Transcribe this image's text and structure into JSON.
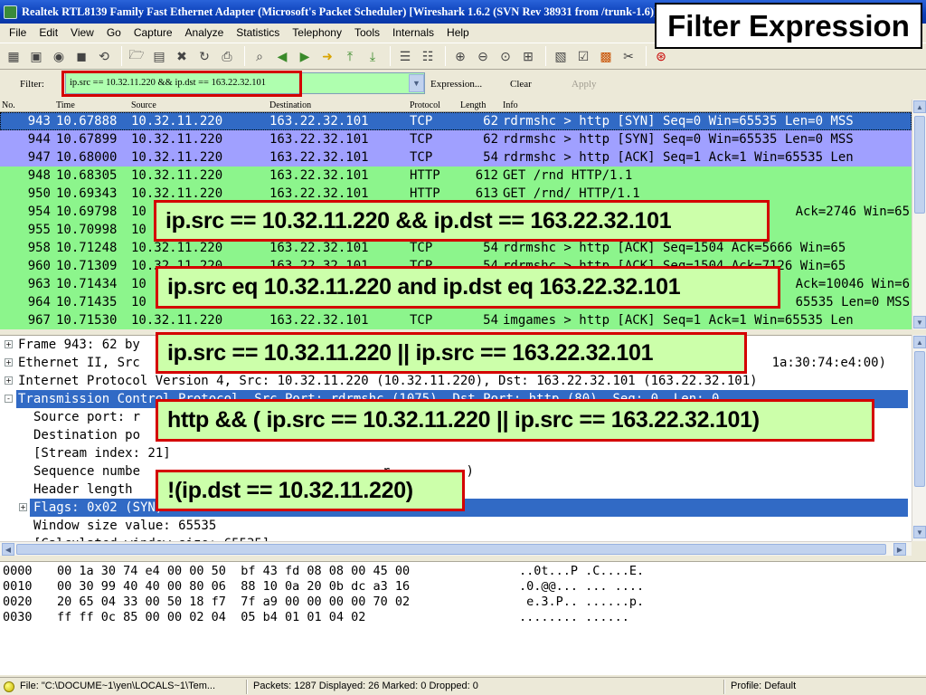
{
  "window": {
    "title": "Realtek RTL8139 Family Fast Ethernet Adapter (Microsoft's Packet Scheduler)    [Wireshark 1.6.2  (SVN Rev 38931 from /trunk-1.6)]"
  },
  "banner": {
    "text": "Filter Expression"
  },
  "menu": {
    "items": [
      "File",
      "Edit",
      "View",
      "Go",
      "Capture",
      "Analyze",
      "Statistics",
      "Telephony",
      "Tools",
      "Internals",
      "Help"
    ]
  },
  "filter": {
    "label": "Filter:",
    "value": "ip.src == 10.32.11.220 && ip.dst == 163.22.32.101",
    "expression_label": "Expression...",
    "clear_label": "Clear",
    "apply_label": "Apply",
    "input_color": "#afffaf"
  },
  "packet_list": {
    "headers": [
      "No.",
      "Time",
      "Source",
      "Destination",
      "Protocol",
      "Length",
      "Info"
    ],
    "rows": [
      {
        "no": "943",
        "time": "10.67888",
        "src": "10.32.11.220",
        "dst": "163.22.32.101",
        "proto": "TCP",
        "len": "62",
        "info": "rdrmshc > http [SYN] Seq=0 Win=65535 Len=0 MSS",
        "selected": true
      },
      {
        "no": "944",
        "time": "10.67899",
        "src": "10.32.11.220",
        "dst": "163.22.32.101",
        "proto": "TCP",
        "len": "62",
        "info": "rdrmshc > http [SYN] Seq=0 Win=65535 Len=0 MSS",
        "color": "#a0a0ff"
      },
      {
        "no": "947",
        "time": "10.68000",
        "src": "10.32.11.220",
        "dst": "163.22.32.101",
        "proto": "TCP",
        "len": "54",
        "info": "rdrmshc > http [ACK] Seq=1 Ack=1 Win=65535 Len",
        "color": "#a0a0ff"
      },
      {
        "no": "948",
        "time": "10.68305",
        "src": "10.32.11.220",
        "dst": "163.22.32.101",
        "proto": "HTTP",
        "len": "612",
        "info": "GET /rnd HTTP/1.1",
        "color": "#8cf58c"
      },
      {
        "no": "950",
        "time": "10.69343",
        "src": "10.32.11.220",
        "dst": "163.22.32.101",
        "proto": "HTTP",
        "len": "613",
        "info": "GET /rnd/ HTTP/1.1",
        "color": "#8cf58c"
      },
      {
        "no": "954",
        "time": "10.69798",
        "src": "10",
        "dst": "",
        "proto": "",
        "len": "",
        "info": "Ack=2746 Win=65",
        "color": "#8cf58c"
      },
      {
        "no": "955",
        "time": "10.70998",
        "src": "10",
        "dst": "",
        "proto": "",
        "len": "",
        "info": "",
        "color": "#8cf58c"
      },
      {
        "no": "958",
        "time": "10.71248",
        "src": "10.32.11.220",
        "dst": "163.22.32.101",
        "proto": "TCP",
        "len": "54",
        "info": "rdrmshc > http [ACK] Seq=1504 Ack=5666 Win=65",
        "color": "#8cf58c"
      },
      {
        "no": "960",
        "time": "10.71309",
        "src": "10.32.11.220",
        "dst": "163.22.32.101",
        "proto": "TCP",
        "len": "54",
        "info": "rdrmshc > http [ACK] Seq=1504 Ack=7126 Win=65",
        "color": "#8cf58c"
      },
      {
        "no": "963",
        "time": "10.71434",
        "src": "10",
        "dst": "",
        "proto": "",
        "len": "",
        "info": "Ack=10046 Win=6",
        "color": "#8cf58c"
      },
      {
        "no": "964",
        "time": "10.71435",
        "src": "10",
        "dst": "",
        "proto": "",
        "len": "",
        "info": "65535 Len=0 MSS",
        "color": "#8cf58c"
      },
      {
        "no": "967",
        "time": "10.71530",
        "src": "10.32.11.220",
        "dst": "163.22.32.101",
        "proto": "TCP",
        "len": "54",
        "info": "imgames > http [ACK] Seq=1 Ack=1 Win=65535 Len",
        "color": "#8cf58c"
      }
    ]
  },
  "details": {
    "rows": [
      {
        "text": "Frame 943: 62 by",
        "exp": "+",
        "level": 0
      },
      {
        "text": "Ethernet II, Src",
        "tail": "1a:30:74:e4:00)",
        "exp": "+",
        "level": 0
      },
      {
        "text": "Internet Protocol Version 4, Src: 10.32.11.220 (10.32.11.220), Dst: 163.22.32.101 (163.22.32.101)",
        "exp": "+",
        "level": 0
      },
      {
        "text": "Transmission Control Protocol, Src Port: rdrmshc (1075), Dst Port: http (80), Seq: 0, Len: 0",
        "exp": "-",
        "level": 0,
        "selected": true
      },
      {
        "text": "Source port: r",
        "level": 1
      },
      {
        "text": "Destination po",
        "level": 1
      },
      {
        "text": "[Stream index: 21]",
        "level": 1
      },
      {
        "text": "Sequence numbe",
        "tail": "r          )",
        "level": 1
      },
      {
        "text": "Header length",
        "level": 1
      },
      {
        "text": "Flags: 0x02 (SYN)",
        "exp": "+",
        "level": 1,
        "highlight": true
      },
      {
        "text": "Window size value: 65535",
        "level": 1
      },
      {
        "text": "[Calculated window size: 65535]",
        "level": 1
      }
    ]
  },
  "bytes": {
    "rows": [
      {
        "offset": "0000",
        "hex": "00 1a 30 74 e4 00 00 50  bf 43 fd 08 08 00 45 00",
        "ascii": "..0t...P .C....E."
      },
      {
        "offset": "0010",
        "hex": "00 30 99 40 40 00 80 06  88 10 0a 20 0b dc a3 16",
        "ascii": ".0.@@... ... ...."
      },
      {
        "offset": "0020",
        "hex": "20 65 04 33 00 50 18 f7  7f a9 00 00 00 00 70 02",
        "ascii": " e.3.P.. ......p."
      },
      {
        "offset": "0030",
        "hex": "ff ff 0c 85 00 00 02 04  05 b4 01 01 04 02",
        "ascii": "........ ......"
      }
    ]
  },
  "status": {
    "file": "File: \"C:\\DOCUME~1\\yen\\LOCALS~1\\Tem...",
    "packets": "Packets: 1287 Displayed: 26 Marked: 0 Dropped: 0",
    "profile": "Profile: Default"
  },
  "callouts": [
    "ip.src == 10.32.11.220 && ip.dst == 163.22.32.101",
    "ip.src eq 10.32.11.220 and ip.dst eq 163.22.32.101",
    "ip.src == 10.32.11.220 || ip.src == 163.22.32.101",
    "http && ( ip.src == 10.32.11.220 || ip.src == 163.22.32.101)",
    "!(ip.dst == 10.32.11.220)"
  ],
  "colors": {
    "selection": "#316ac5",
    "tcp_row": "#a0a0ff",
    "http_row": "#8cf58c",
    "callout_bg": "#ccffaa",
    "callout_border": "#d40000"
  }
}
